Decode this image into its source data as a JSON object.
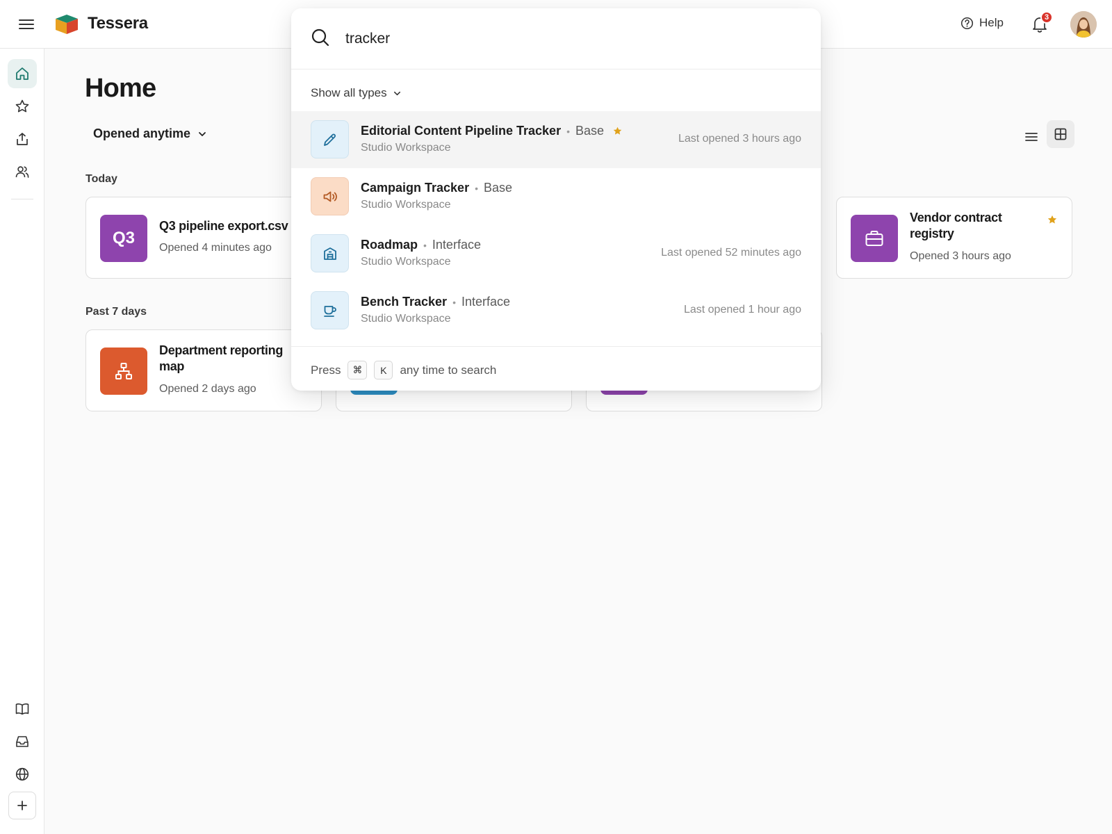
{
  "app": {
    "brand": "Tessera"
  },
  "topbar": {
    "help_label": "Help",
    "notification_count": "3"
  },
  "home": {
    "title": "Home",
    "filter_label": "Opened anytime",
    "sections": {
      "today": "Today",
      "past7": "Past 7 days"
    },
    "cards": [
      {
        "icon_text": "Q3",
        "title": "Q3 pipeline export.csv",
        "subtitle": "Opened 4 minutes ago",
        "color": "#8e44ad"
      },
      {
        "title": "Vendor contract registry",
        "subtitle": "Opened 3 hours ago",
        "color": "#8e44ad",
        "icon": "briefcase-icon",
        "starred": true
      },
      {
        "title": "Department reporting map",
        "subtitle": "Opened 2 days ago",
        "color": "#dc5a2e",
        "icon": "hierarchy-icon"
      }
    ]
  },
  "search": {
    "query": "tracker",
    "type_filter_label": "Show all types",
    "results": [
      {
        "name": "Editorial Content Pipeline Tracker",
        "type": "Base",
        "workspace": "Studio Workspace",
        "last_opened": "Last opened 3 hours ago",
        "starred": true,
        "icon": "pencil-icon"
      },
      {
        "name": "Campaign Tracker",
        "type": "Base",
        "workspace": "Studio Workspace",
        "last_opened": "",
        "icon": "megaphone-icon"
      },
      {
        "name": "Roadmap",
        "type": "Interface",
        "workspace": "Studio Workspace",
        "last_opened": "Last opened 52 minutes ago",
        "icon": "building-icon"
      },
      {
        "name": "Bench Tracker",
        "type": "Interface",
        "workspace": "Studio Workspace",
        "last_opened": "Last opened 1 hour ago",
        "icon": "coffee-cup-icon"
      }
    ],
    "hint": {
      "press": "Press",
      "key1": "⌘",
      "key2": "K",
      "suffix": "any time to search"
    }
  },
  "colors": {
    "accent": "#1f7a6e",
    "star": "#e0a21b",
    "badge": "#d9342b"
  }
}
